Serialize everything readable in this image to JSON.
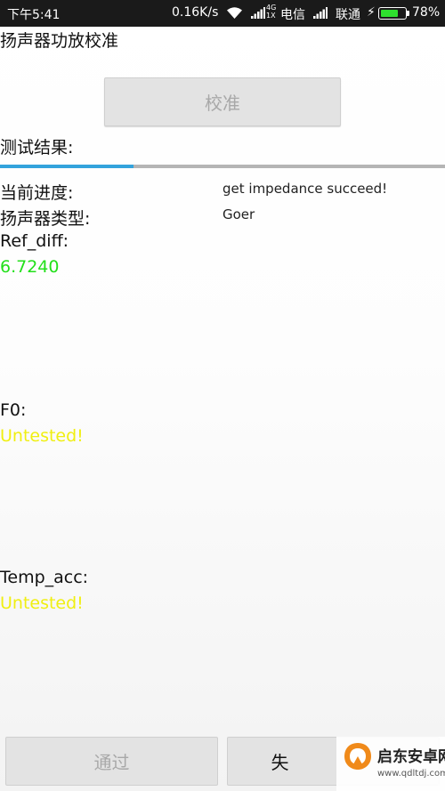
{
  "status_bar": {
    "time": "下午5:41",
    "speed": "0.16K/s",
    "network_type": "4G 1X",
    "carrier1": "电信",
    "carrier2": "联通",
    "battery_pct": "78%",
    "battery_level": 0.78,
    "battery_color": "#2ee02e"
  },
  "page": {
    "title": "扬声器功放校准",
    "calibrate_button": "校准",
    "result_label": "测试结果:",
    "progress": 0.3,
    "progress_color": "#33a3dc"
  },
  "results": {
    "progress_label": "当前进度:",
    "progress_value": "get impedance succeed!",
    "speaker_type_label": "扬声器类型:",
    "speaker_type_value": "Goer",
    "ref_diff_label": "Ref_diff:",
    "ref_diff_value": "6.7240",
    "f0_label": "F0:",
    "f0_value": "Untested!",
    "temp_acc_label": "Temp_acc:",
    "temp_acc_value": "Untested!"
  },
  "footer": {
    "pass_button": "通过",
    "fail_button": "失"
  },
  "watermark": {
    "text": "启东安卓网",
    "url": "www.qdltdj.com"
  }
}
